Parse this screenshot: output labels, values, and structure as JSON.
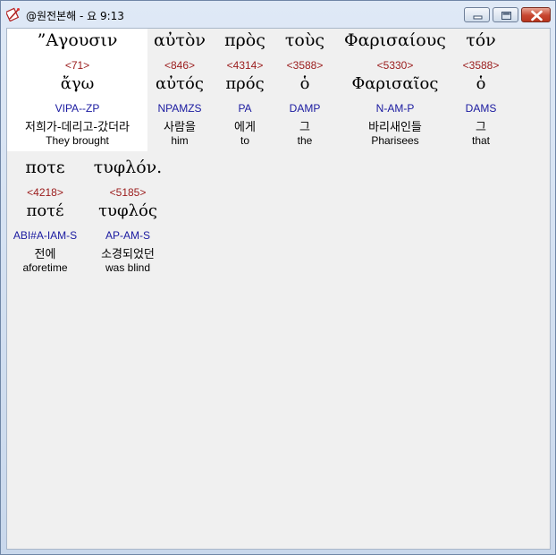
{
  "window": {
    "title": "@원전본해 - 요 9:13"
  },
  "icons": {
    "app": "book-pen-icon",
    "minimize": "minimize-icon",
    "maximize": "maximize-icon",
    "close": "close-icon"
  },
  "colors": {
    "strong_number": "#9a1b1b",
    "parsing": "#1a1aa0",
    "selected_background": "#ffffff",
    "close_button": "#c74630"
  },
  "words": [
    {
      "greek": "”Αγουσιν",
      "strong": "<71>",
      "lemma": "ἄγω",
      "parse": "VIPA--ZP",
      "korean": "저희가-데리고-갔더라",
      "english": "They brought",
      "selected": true
    },
    {
      "greek": "αὐτὸν",
      "strong": "<846>",
      "lemma": "αὐτός",
      "parse": "NPAMZS",
      "korean": "사람을",
      "english": "him",
      "selected": false
    },
    {
      "greek": "πρὸς",
      "strong": "<4314>",
      "lemma": "πρός",
      "parse": "PA",
      "korean": "에게",
      "english": "to",
      "selected": false
    },
    {
      "greek": "τοὺς",
      "strong": "<3588>",
      "lemma": "ὁ",
      "parse": "DAMP",
      "korean": "그",
      "english": "the",
      "selected": false
    },
    {
      "greek": "Φαρισαίους",
      "strong": "<5330>",
      "lemma": "Φαρισαῖος",
      "parse": "N-AM-P",
      "korean": "바리새인들",
      "english": "Pharisees",
      "selected": false
    },
    {
      "greek": "τόν",
      "strong": "<3588>",
      "lemma": "ὁ",
      "parse": "DAMS",
      "korean": "그",
      "english": "that",
      "selected": false
    },
    {
      "greek": "ποτε",
      "strong": "<4218>",
      "lemma": "ποτέ",
      "parse": "ABI#A-IAM-S",
      "korean": "전에",
      "english": "aforetime",
      "selected": false
    },
    {
      "greek": "τυφλόν.",
      "strong": "<5185>",
      "lemma": "τυφλός",
      "parse": "AP-AM-S",
      "korean": "소경되었던",
      "english": "was blind",
      "selected": false
    }
  ]
}
